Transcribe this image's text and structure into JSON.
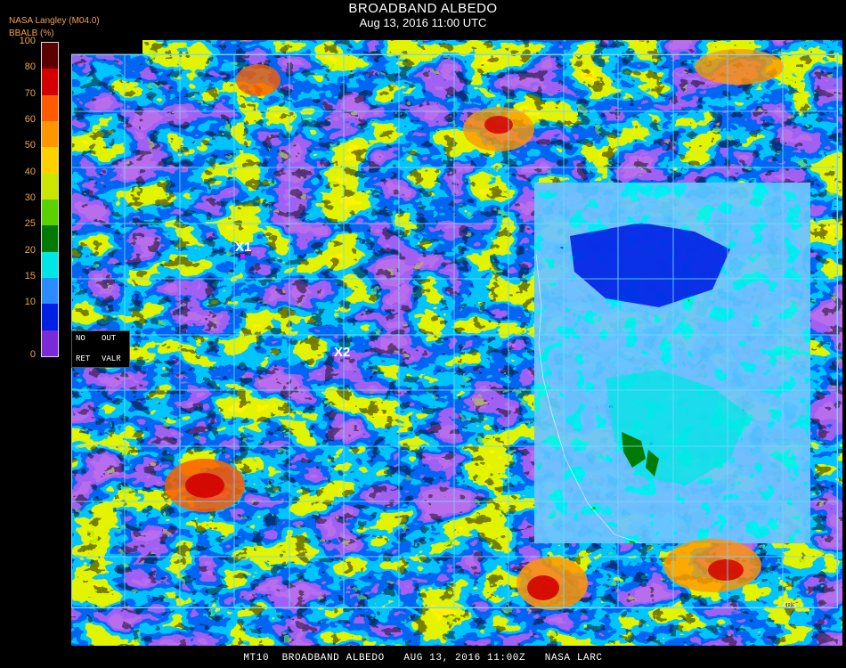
{
  "header": {
    "title": "BROADBAND ALBEDO",
    "subtitle": "Aug 13, 2016 11:00 UTC",
    "source": "NASA Langley (M04.0)"
  },
  "colorbar": {
    "label": "BBALB (%)",
    "ticks": [
      "100",
      "80",
      "70",
      "60",
      "50",
      "40",
      "30",
      "25",
      "20",
      "15",
      "10",
      "0"
    ],
    "colors": [
      "#5a0000",
      "#d40000",
      "#ff5a00",
      "#ff9600",
      "#ffd000",
      "#c8e600",
      "#5ad200",
      "#007a00",
      "#00e6e6",
      "#2a8cff",
      "#0020e6",
      "#7a2ad6"
    ]
  },
  "nodata": {
    "no": "NO",
    "out": "OUT",
    "ret": "RET",
    "valr": "VALR"
  },
  "markers": {
    "x1": "X1",
    "x2": "X2"
  },
  "grid_labels": {
    "lat_40s": "40S"
  },
  "footer": "MT10  BROADBAND ALBEDO   AUG 13, 2016 11:00Z   NASA LARC"
}
